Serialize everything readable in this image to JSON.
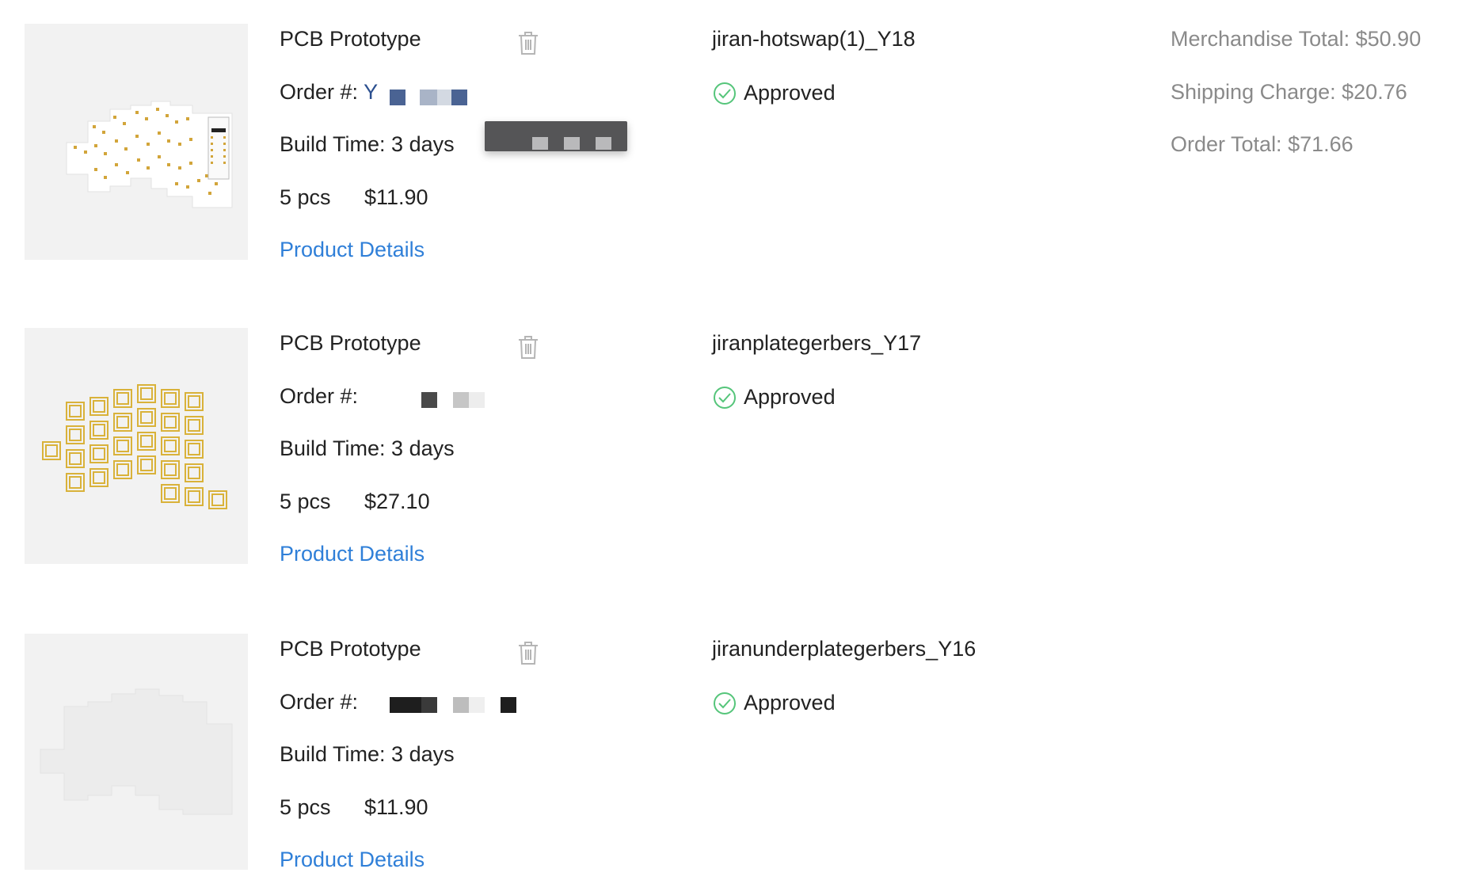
{
  "summary": {
    "merchandise_total": "Merchandise Total: $50.90",
    "shipping_charge": "Shipping Charge: $20.76",
    "order_total": "Order Total: $71.66"
  },
  "orders": [
    {
      "product": "PCB Prototype",
      "order_label": "Order #:",
      "order_prefix": "Y",
      "build_time": "Build Time: 3 days",
      "quantity": "5 pcs",
      "price": "$11.90",
      "details_link": "Product Details",
      "file_name": "jiran-hotswap(1)_Y18",
      "status": "Approved"
    },
    {
      "product": "PCB Prototype",
      "order_label": "Order #:",
      "build_time": "Build Time: 3 days",
      "quantity": "5 pcs",
      "price": "$27.10",
      "details_link": "Product Details",
      "file_name": "jiranplategerbers_Y17",
      "status": "Approved"
    },
    {
      "product": "PCB Prototype",
      "order_label": "Order #:",
      "build_time": "Build Time: 3 days",
      "quantity": "5 pcs",
      "price": "$11.90",
      "details_link": "Product Details",
      "file_name": "jiranunderplategerbers_Y16",
      "status": "Approved"
    }
  ],
  "icons": {
    "delete": "trash-icon",
    "approved": "check-circle-icon"
  },
  "colors": {
    "link": "#2f7fd8",
    "approved": "#55c57a",
    "muted": "#8a8a8a",
    "pcb_gold": "#d9b23a"
  }
}
